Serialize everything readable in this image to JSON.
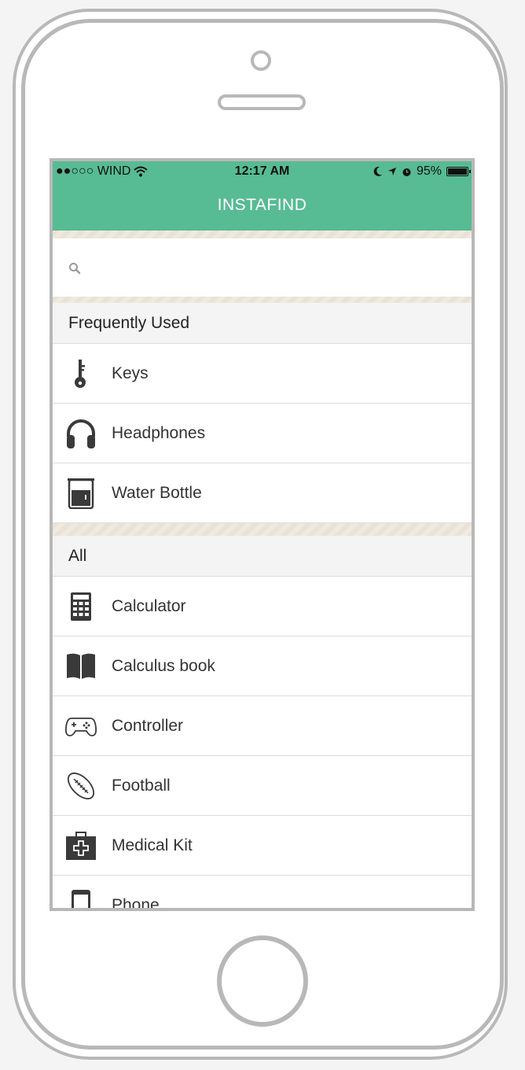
{
  "status_bar": {
    "carrier": "●●○○○ WIND",
    "time": "12:17 AM",
    "battery": "95%",
    "battery_level": 0.95
  },
  "app": {
    "title": "INSTAFIND"
  },
  "search": {
    "placeholder": ""
  },
  "sections": {
    "frequent": {
      "title": "Frequently Used",
      "items": [
        {
          "label": "Keys",
          "icon": "key-icon"
        },
        {
          "label": "Headphones",
          "icon": "headphones-icon"
        },
        {
          "label": "Water Bottle",
          "icon": "water-bottle-icon"
        }
      ]
    },
    "all": {
      "title": "All",
      "items": [
        {
          "label": "Calculator",
          "icon": "calculator-icon"
        },
        {
          "label": "Calculus book",
          "icon": "book-icon"
        },
        {
          "label": "Controller",
          "icon": "controller-icon"
        },
        {
          "label": "Football",
          "icon": "football-icon"
        },
        {
          "label": "Medical Kit",
          "icon": "medical-kit-icon"
        },
        {
          "label": "Phone",
          "icon": "phone-icon"
        }
      ]
    }
  },
  "colors": {
    "accent": "#57bb94",
    "device_outline": "#b8b8b8",
    "icon": "#3a3a3a"
  }
}
